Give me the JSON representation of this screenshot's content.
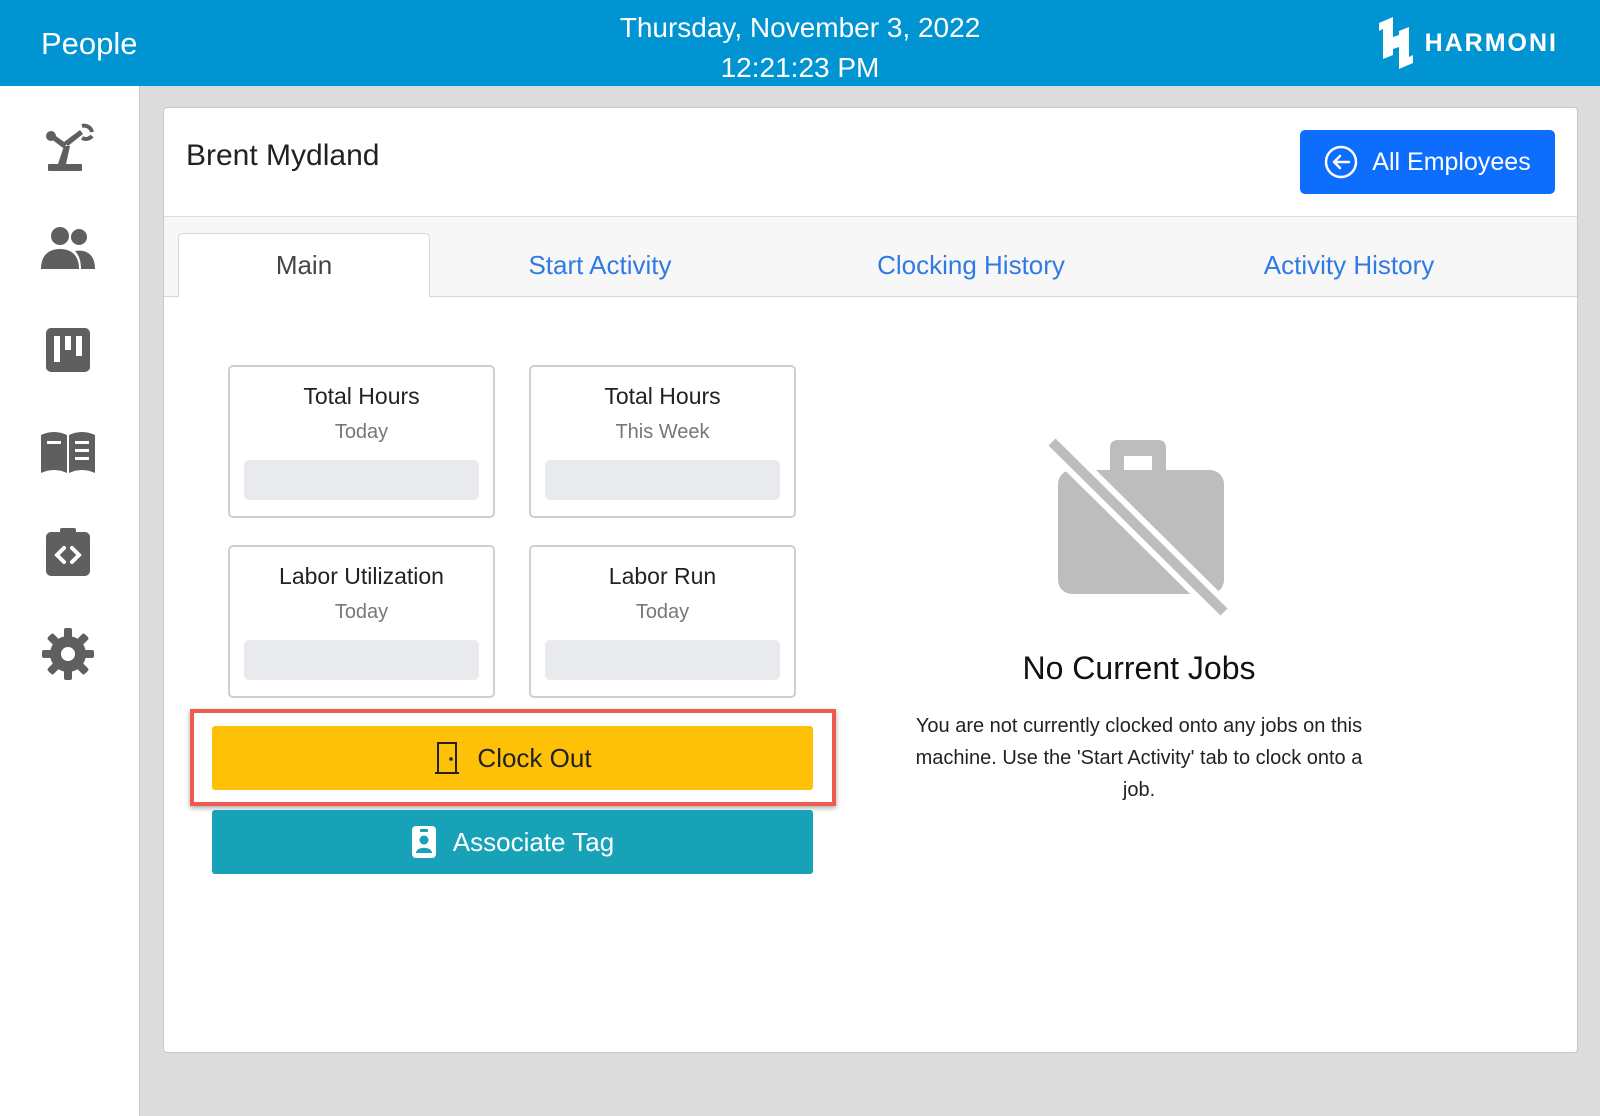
{
  "header": {
    "app_title": "People",
    "date": "Thursday, November 3, 2022",
    "time": "12:21:23 PM",
    "logo_text": "HARMONI"
  },
  "sidebar": {
    "items": [
      {
        "icon": "robot-arm-icon"
      },
      {
        "icon": "people-icon"
      },
      {
        "icon": "board-icon"
      },
      {
        "icon": "book-icon"
      },
      {
        "icon": "clipboard-code-icon"
      },
      {
        "icon": "gear-icon"
      }
    ]
  },
  "employee": {
    "name": "Brent Mydland",
    "all_employees_label": "All Employees"
  },
  "tabs": [
    {
      "label": "Main",
      "active": true
    },
    {
      "label": "Start Activity",
      "active": false
    },
    {
      "label": "Clocking History",
      "active": false
    },
    {
      "label": "Activity History",
      "active": false
    }
  ],
  "stats": [
    {
      "title": "Total Hours",
      "subtitle": "Today",
      "value": ""
    },
    {
      "title": "Total Hours",
      "subtitle": "This Week",
      "value": ""
    },
    {
      "title": "Labor Utilization",
      "subtitle": "Today",
      "value": ""
    },
    {
      "title": "Labor Run",
      "subtitle": "Today",
      "value": ""
    }
  ],
  "actions": {
    "clock_out_label": "Clock Out",
    "associate_tag_label": "Associate Tag"
  },
  "empty_state": {
    "title": "No Current Jobs",
    "message": "You are not currently clocked onto any jobs on this machine. Use the 'Start Activity' tab to clock onto a job."
  },
  "colors": {
    "header_bg": "#0094d2",
    "primary_button": "#0d6efd",
    "clock_out": "#ffc107",
    "associate_tag": "#17a2b8",
    "highlight": "#ee5a4f",
    "tab_link": "#2f7ae5",
    "icon_gray": "#5f5f5f"
  }
}
